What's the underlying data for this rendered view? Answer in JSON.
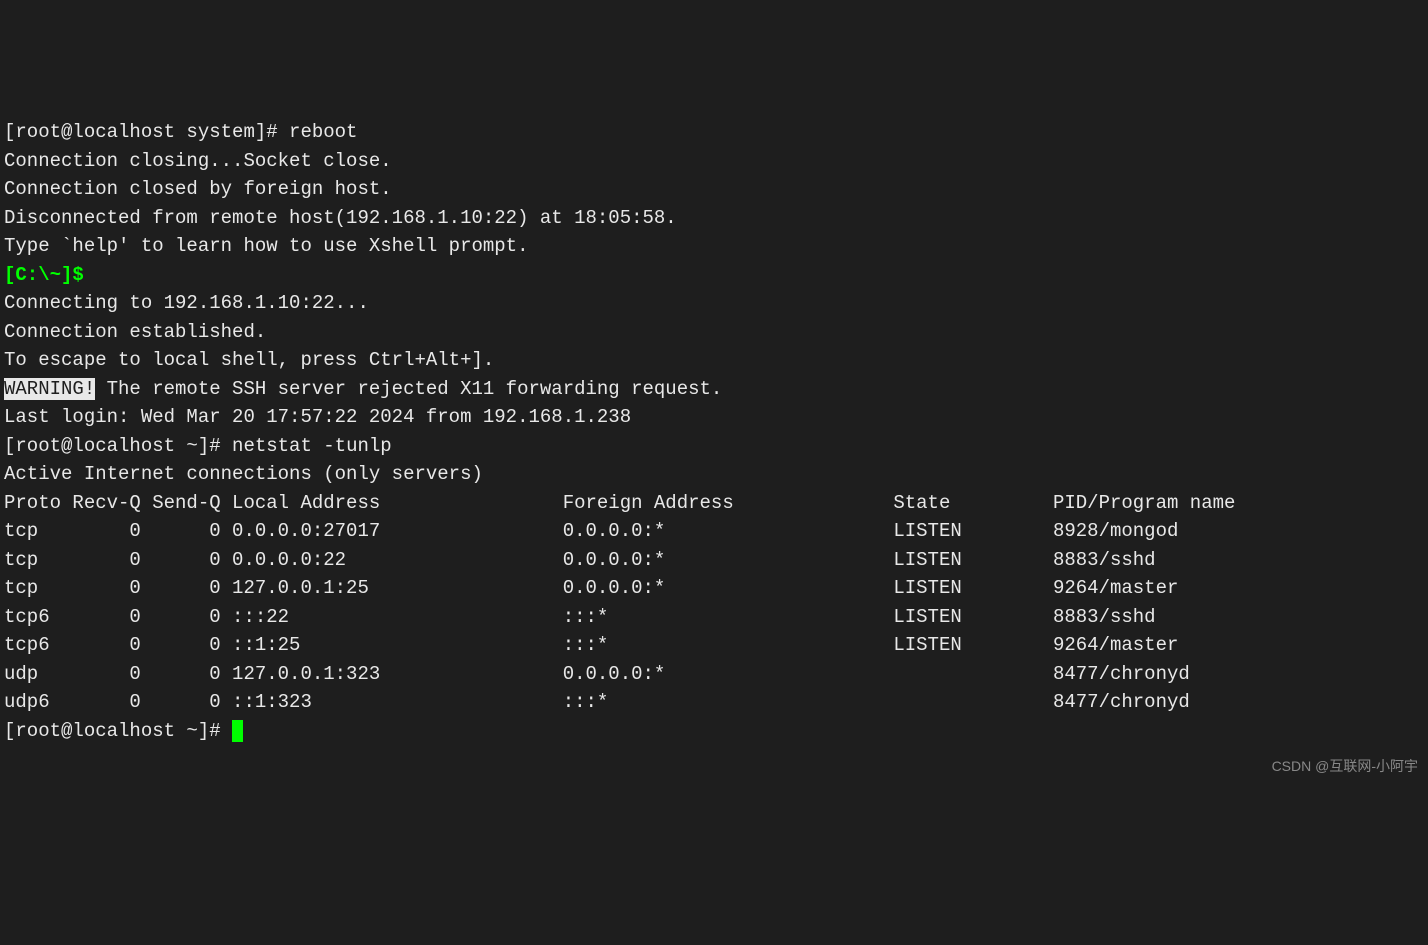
{
  "lines": {
    "l1_prompt": "[root@localhost system]# ",
    "l1_cmd": "reboot",
    "l2": "Connection closing...Socket close.",
    "l3": "",
    "l4": "Connection closed by foreign host.",
    "l5": "",
    "l6": "Disconnected from remote host(192.168.1.10:22) at 18:05:58.",
    "l7": "",
    "l8": "Type `help' to learn how to use Xshell prompt.",
    "l9": "[C:\\~]$ ",
    "l10": "",
    "l11": "Connecting to 192.168.1.10:22...",
    "l12": "Connection established.",
    "l13": "To escape to local shell, press Ctrl+Alt+].",
    "l14": "",
    "l15_warn": "WARNING!",
    "l15_rest": " The remote SSH server rejected X11 forwarding request.",
    "l16": "Last login: Wed Mar 20 17:57:22 2024 from 192.168.1.238",
    "l17_prompt": "[root@localhost ~]# ",
    "l17_cmd": "netstat -tunlp",
    "l18": "Active Internet connections (only servers)",
    "l19_prompt": "[root@localhost ~]# "
  },
  "netstat": {
    "headers": {
      "proto": "Proto",
      "recvq": "Recv-Q",
      "sendq": "Send-Q",
      "local": "Local Address",
      "foreign": "Foreign Address",
      "state": "State",
      "pid": "PID/Program name"
    },
    "rows": [
      {
        "proto": "tcp",
        "recvq": "0",
        "sendq": "0",
        "local": "0.0.0.0:27017",
        "foreign": "0.0.0.0:*",
        "state": "LISTEN",
        "pid": "8928/mongod"
      },
      {
        "proto": "tcp",
        "recvq": "0",
        "sendq": "0",
        "local": "0.0.0.0:22",
        "foreign": "0.0.0.0:*",
        "state": "LISTEN",
        "pid": "8883/sshd"
      },
      {
        "proto": "tcp",
        "recvq": "0",
        "sendq": "0",
        "local": "127.0.0.1:25",
        "foreign": "0.0.0.0:*",
        "state": "LISTEN",
        "pid": "9264/master"
      },
      {
        "proto": "tcp6",
        "recvq": "0",
        "sendq": "0",
        "local": ":::22",
        "foreign": ":::*",
        "state": "LISTEN",
        "pid": "8883/sshd"
      },
      {
        "proto": "tcp6",
        "recvq": "0",
        "sendq": "0",
        "local": "::1:25",
        "foreign": ":::*",
        "state": "LISTEN",
        "pid": "9264/master"
      },
      {
        "proto": "udp",
        "recvq": "0",
        "sendq": "0",
        "local": "127.0.0.1:323",
        "foreign": "0.0.0.0:*",
        "state": "",
        "pid": "8477/chronyd"
      },
      {
        "proto": "udp6",
        "recvq": "0",
        "sendq": "0",
        "local": "::1:323",
        "foreign": ":::*",
        "state": "",
        "pid": "8477/chronyd"
      }
    ]
  },
  "watermark": "CSDN @互联网-小阿宇"
}
